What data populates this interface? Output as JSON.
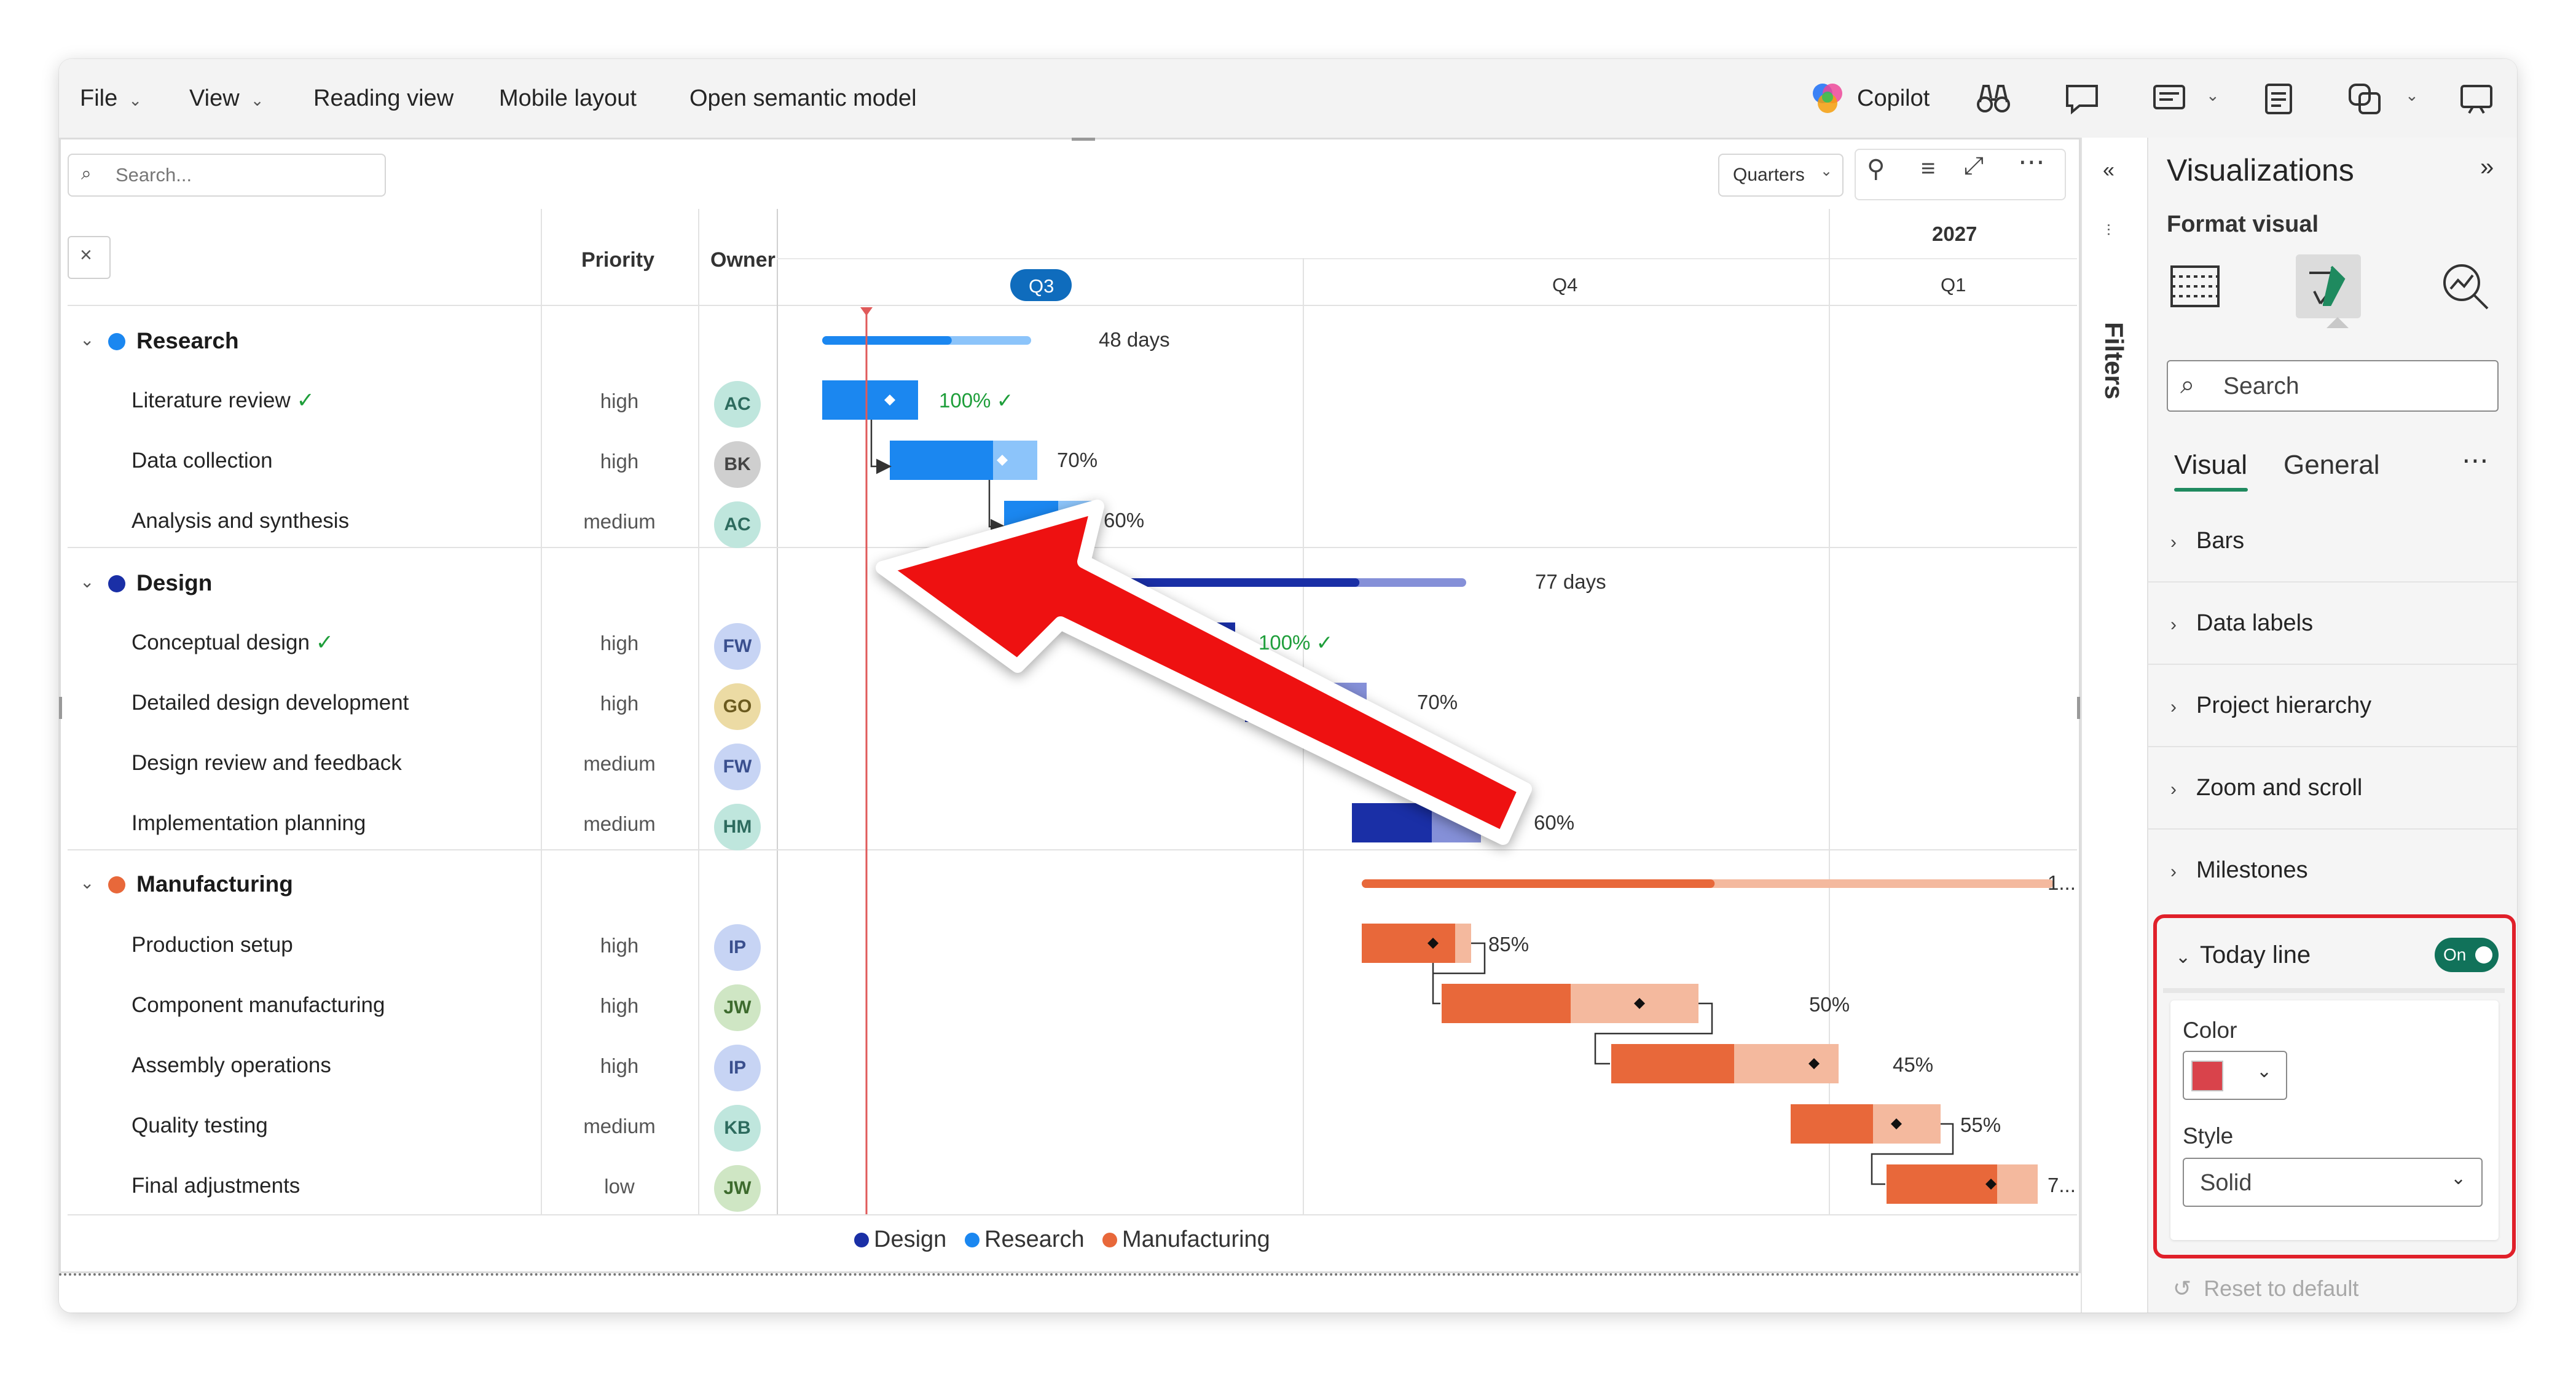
{
  "menu": {
    "file": "File",
    "view": "View",
    "reading_view": "Reading view",
    "mobile_layout": "Mobile layout",
    "open_semantic_model": "Open semantic model",
    "copilot": "Copilot"
  },
  "visual": {
    "search_placeholder": "Search...",
    "timescale": "Quarters",
    "columns": {
      "priority": "Priority",
      "owner": "Owner"
    },
    "year": "2027",
    "quarters": [
      "Q3",
      "Q4",
      "Q1"
    ],
    "groups": [
      {
        "name": "Research",
        "color": "#1b87f0",
        "duration": "48 days",
        "tasks": [
          {
            "name": "Literature review",
            "done": true,
            "priority": "high",
            "owner": "AC",
            "progress_label": "100%"
          },
          {
            "name": "Data collection",
            "done": false,
            "priority": "high",
            "owner": "BK",
            "progress_label": "70%"
          },
          {
            "name": "Analysis and synthesis",
            "done": false,
            "priority": "medium",
            "owner": "AC",
            "progress_label": "60%"
          }
        ]
      },
      {
        "name": "Design",
        "color": "#1a2fa6",
        "duration": "77 days",
        "tasks": [
          {
            "name": "Conceptual design",
            "done": true,
            "priority": "high",
            "owner": "FW",
            "progress_label": "100%"
          },
          {
            "name": "Detailed design development",
            "done": false,
            "priority": "high",
            "owner": "GO",
            "progress_label": "70%"
          },
          {
            "name": "Design review and feedback",
            "done": false,
            "priority": "medium",
            "owner": "FW",
            "progress_label": ""
          },
          {
            "name": "Implementation planning",
            "done": false,
            "priority": "medium",
            "owner": "HM",
            "progress_label": "60%"
          }
        ]
      },
      {
        "name": "Manufacturing",
        "color": "#e8683a",
        "duration": "1...",
        "tasks": [
          {
            "name": "Production setup",
            "done": false,
            "priority": "high",
            "owner": "IP",
            "progress_label": "85%"
          },
          {
            "name": "Component manufacturing",
            "done": false,
            "priority": "high",
            "owner": "JW",
            "progress_label": "50%"
          },
          {
            "name": "Assembly operations",
            "done": false,
            "priority": "high",
            "owner": "IP",
            "progress_label": "45%"
          },
          {
            "name": "Quality testing",
            "done": false,
            "priority": "medium",
            "owner": "KB",
            "progress_label": "55%"
          },
          {
            "name": "Final adjustments",
            "done": false,
            "priority": "low",
            "owner": "JW",
            "progress_label": "7..."
          }
        ]
      }
    ],
    "legend": [
      "Design",
      "Research",
      "Manufacturing"
    ]
  },
  "filters_label": "Filters",
  "viz_pane": {
    "title": "Visualizations",
    "subtitle": "Format visual",
    "search_placeholder": "Search",
    "tabs": [
      "Visual",
      "General"
    ],
    "sections": [
      "Bars",
      "Data labels",
      "Project hierarchy",
      "Zoom and scroll",
      "Milestones"
    ],
    "today_line": {
      "label": "Today line",
      "toggle": "On",
      "color_label": "Color",
      "color": "#d9434b",
      "style_label": "Style",
      "style_value": "Solid"
    },
    "reset": "Reset to default"
  },
  "colors": {
    "research": "#1b87f0",
    "research_light": "#8cc4fa",
    "design": "#1a2fa6",
    "design_light": "#8590d8",
    "manufacturing": "#e8683a",
    "manufacturing_light": "#f4b99e",
    "today_line": "#e05a5a",
    "highlight": "#e0202a",
    "arrow": "#ee1111"
  }
}
